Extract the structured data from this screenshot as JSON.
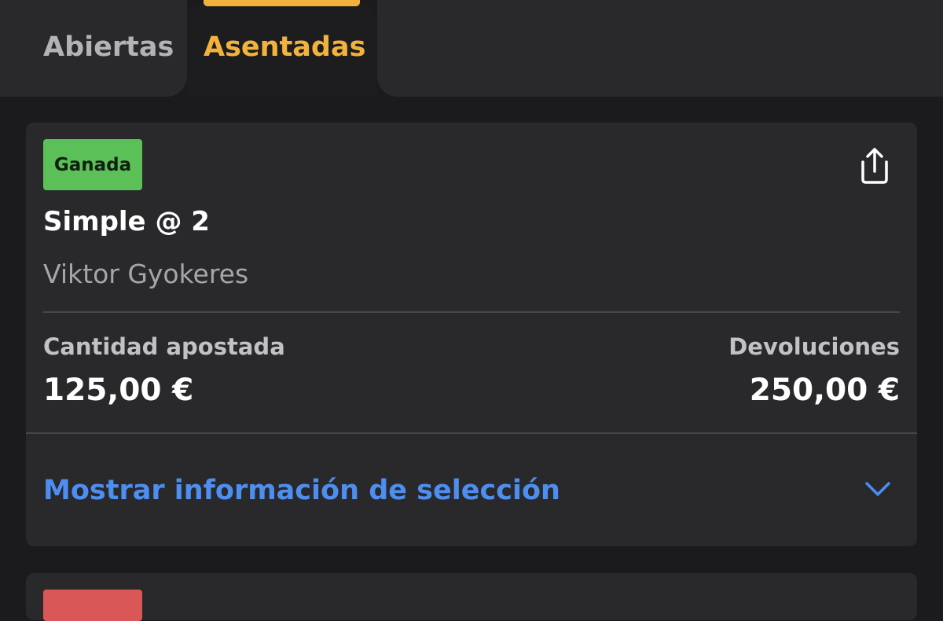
{
  "tabs": {
    "open_label": "Abiertas",
    "settled_label": "Asentadas",
    "active": "Asentadas"
  },
  "bet": {
    "status": "Ganada",
    "title": "Simple @ 2",
    "selection": "Viktor Gyokeres",
    "stake_label": "Cantidad apostada",
    "stake_value": "125,00 €",
    "returns_label": "Devoluciones",
    "returns_value": "250,00 €",
    "expand_label": "Mostrar información de selección",
    "share_icon": "share-icon",
    "chevron_icon": "chevron-down-icon"
  },
  "colors": {
    "accent": "#f2b33d",
    "won": "#5cc058",
    "lost": "#d95757",
    "link": "#4d8ef0"
  }
}
